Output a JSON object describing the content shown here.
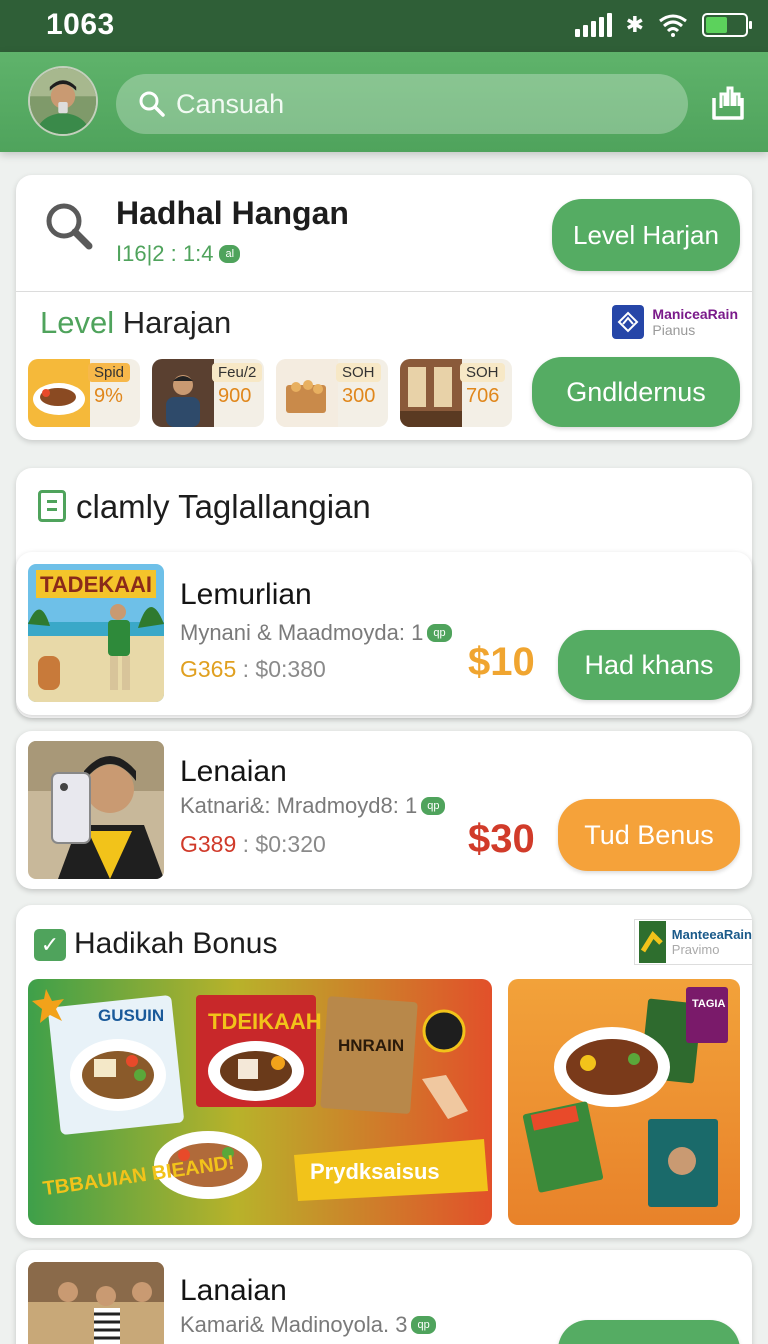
{
  "status_bar": {
    "time": "1063"
  },
  "header": {
    "search_placeholder": "Cansuah"
  },
  "card_main": {
    "title": "Hadhal Hangan",
    "subtitle": "I16|2 : 1:4",
    "subtitle_badge": "al",
    "button": "Level Harjan",
    "level_heading_green": "Level",
    "level_heading_rest": " Harajan",
    "partner_line1": "ManiceaRain",
    "partner_line2": "Pianus",
    "promos": [
      {
        "label": "Spid",
        "value": "9%"
      },
      {
        "label": "Feu/2",
        "value": "900"
      },
      {
        "label": "SOH",
        "value": "300"
      },
      {
        "label": "SOH",
        "value": "706"
      }
    ],
    "promo_button": "Gndldernus"
  },
  "section": {
    "title": "clamly Taglallangian"
  },
  "listings": [
    {
      "title": "Lemurlian",
      "meta": "Mynani & Maadmoyda: 1",
      "meta_badge": "qp",
      "code": "G365",
      "stats": " : $0:380",
      "price": "$10",
      "button": "Had khans",
      "thumb_text": "TADEKAAI"
    },
    {
      "title": "Lenaian",
      "meta": "Katnari&: Mradmoyd8: 1",
      "meta_badge": "qp",
      "code": "G389",
      "stats": " : $0:320",
      "price": "$30",
      "button": "Tud Benus"
    }
  ],
  "bonus": {
    "title": "Hadikah Bonus",
    "partner_line1": "ManteeaRain",
    "partner_line2": "Pravimo",
    "banner_texts": [
      "GUSUIN",
      "TDEIKAAH",
      "HNRAIN",
      "TBBAUIAN BIEAND!",
      "Prydksaisus",
      "TAGIA"
    ]
  },
  "listing_bottom": {
    "title": "Lanaian",
    "meta": "Kamari& Madinoyola. 3",
    "meta_badge": "qp"
  }
}
